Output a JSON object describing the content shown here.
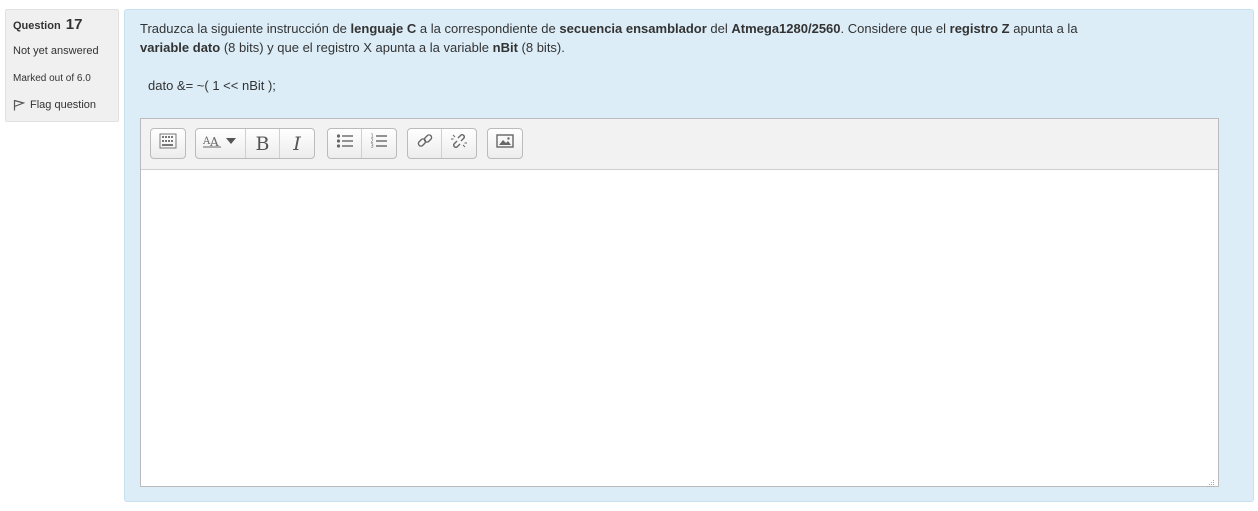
{
  "info": {
    "question_label": "Question",
    "question_number": "17",
    "state": "Not yet answered",
    "grade": "Marked out of 6.0",
    "flag_label": "Flag question"
  },
  "question": {
    "t1": "Traduzca  la siguiente instrucción de ",
    "b1": "lenguaje C",
    "t2": " a la correspondiente de ",
    "b2": "secuencia ensamblador",
    "t3": " del ",
    "b3": "Atmega1280/2560",
    "t4": ".  Considere que el ",
    "b4": "registro Z",
    "t5": " apunta a la ",
    "b5": "variable dato",
    "t6": " (8 bits) y que el registro X apunta a la variable ",
    "b6": "nBit",
    "t7": " (8 bits).",
    "code": "dato &= ~( 1 << nBit );"
  },
  "toolbar": {
    "buttons": [
      {
        "name": "toolbar-toggle",
        "icon": "keyboard-icon"
      },
      {
        "name": "font-style",
        "icon": "font-size-icon"
      },
      {
        "name": "bold",
        "icon": "bold-icon",
        "glyph": "B"
      },
      {
        "name": "italic",
        "icon": "italic-icon",
        "glyph": "I"
      },
      {
        "name": "unordered-list",
        "icon": "bullet-list-icon"
      },
      {
        "name": "ordered-list",
        "icon": "numbered-list-icon"
      },
      {
        "name": "link",
        "icon": "link-icon"
      },
      {
        "name": "unlink",
        "icon": "unlink-icon"
      },
      {
        "name": "image",
        "icon": "image-icon"
      }
    ]
  },
  "editor": {
    "answer_text": ""
  },
  "colors": {
    "content_bg": "#dcedf7",
    "info_bg": "#f0f0f0",
    "toolbar_bg": "#f2f2f2"
  }
}
